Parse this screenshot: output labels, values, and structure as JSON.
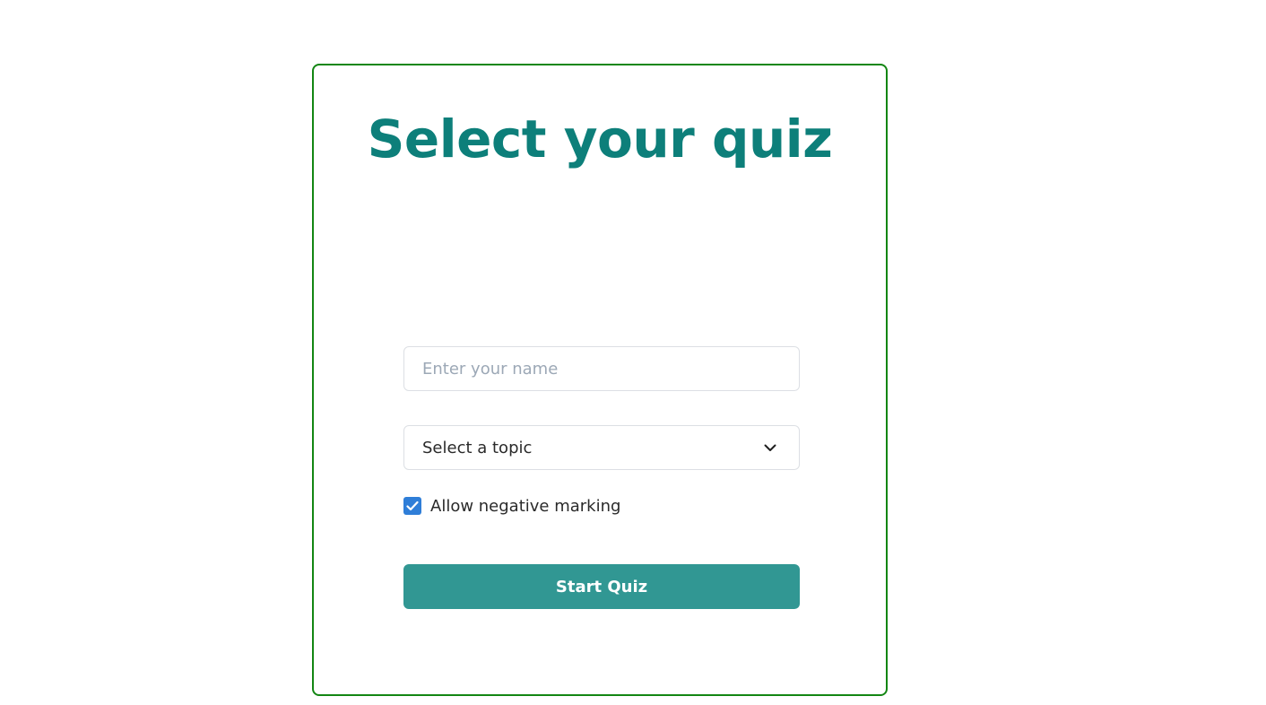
{
  "page": {
    "title": "Select your quiz"
  },
  "form": {
    "name_placeholder": "Enter your name",
    "name_value": "",
    "topic_selected": "Select a topic",
    "negative_marking_label": "Allow negative marking",
    "negative_marking_checked": true,
    "start_label": "Start Quiz"
  },
  "colors": {
    "card_border": "#138613",
    "title": "#0d7f7a",
    "button": "#319793",
    "checkbox": "#2f7ed8"
  },
  "icons": {
    "select_arrow": "chevron-down-icon",
    "checkbox_mark": "checkmark-icon"
  }
}
